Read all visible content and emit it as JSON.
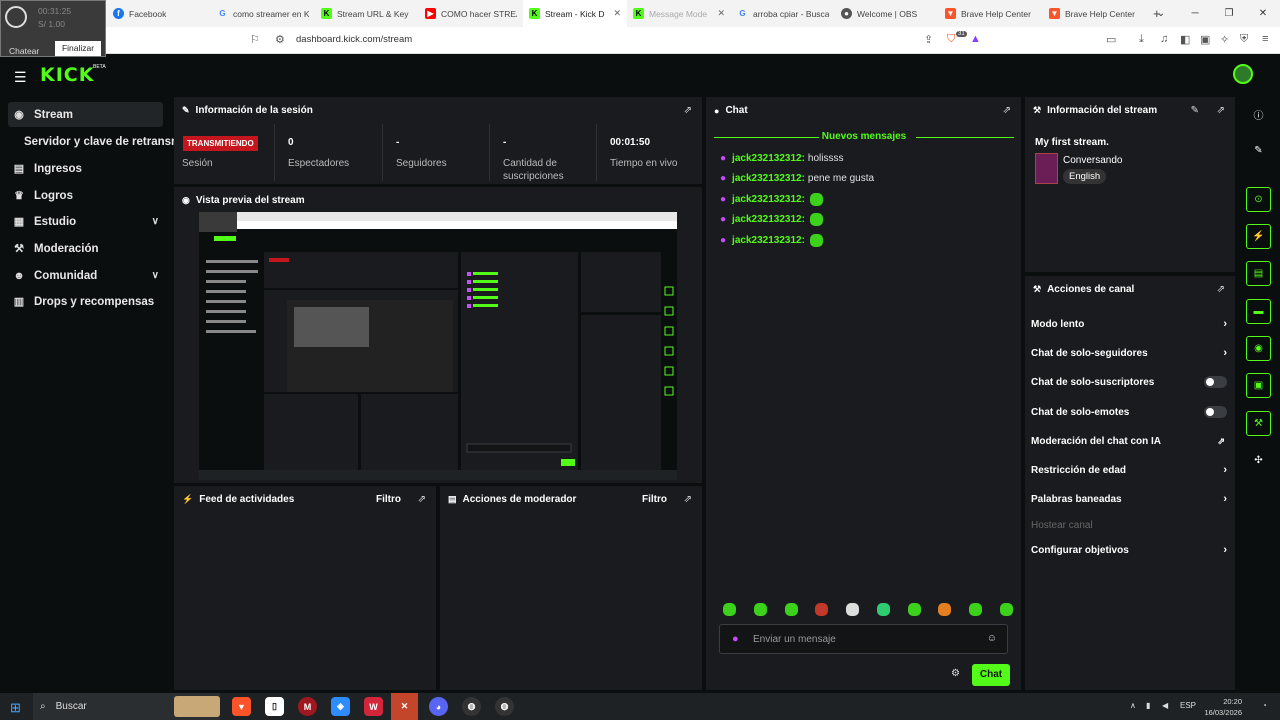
{
  "overlay": {
    "time": "00:31:25",
    "ratio": "S/ 1.00",
    "chat_label": "Chatear",
    "finish_label": "Finalizar"
  },
  "browser": {
    "tabs": [
      {
        "title": "Facebook",
        "color": "#1877f2"
      },
      {
        "title": "como streamer en K",
        "color": "#4285f4"
      },
      {
        "title": "Stream URL & Key",
        "color": "#53fc18"
      },
      {
        "title": "COMO hacer STREA",
        "color": "#ff0000"
      },
      {
        "title": "Stream - Kick D",
        "color": "#53fc18"
      },
      {
        "title": "Message Mode",
        "color": "#53fc18"
      },
      {
        "title": "arroba cpiar - Busca",
        "color": "#4285f4"
      },
      {
        "title": "Welcome | OBS",
        "color": "#555555"
      },
      {
        "title": "Brave Help Center",
        "color": "#fb542b"
      },
      {
        "title": "Brave Help Center",
        "color": "#fb542b"
      }
    ],
    "url": "dashboard.kick.com/stream",
    "shield_count": "31"
  },
  "header": {
    "logo": "KICK",
    "beta": "BETA"
  },
  "sidebar": {
    "items": [
      {
        "label": "Stream",
        "icon": "broadcast-icon"
      },
      {
        "label": "Servidor y clave de retransm"
      },
      {
        "label": "Ingresos",
        "icon": "chart-icon"
      },
      {
        "label": "Logros",
        "icon": "trophy-icon"
      },
      {
        "label": "Estudio",
        "icon": "studio-icon"
      },
      {
        "label": "Moderación",
        "icon": "wrench-icon"
      },
      {
        "label": "Comunidad",
        "icon": "community-icon"
      },
      {
        "label": "Drops y recompensas",
        "icon": "gift-icon"
      }
    ]
  },
  "session": {
    "title": "Información de la sesión",
    "badge": "TRANSMITIENDO",
    "session_label": "Sesión",
    "stats": [
      {
        "value": "0",
        "label": "Espectadores"
      },
      {
        "value": "-",
        "label": "Seguidores"
      },
      {
        "value": "-",
        "label": "Cantidad de suscripciones"
      },
      {
        "value": "00:01:50",
        "label": "Tiempo en vivo"
      }
    ]
  },
  "preview": {
    "title": "Vista previa del stream"
  },
  "activity": {
    "title": "Feed de actividades",
    "filter": "Filtro"
  },
  "modactions": {
    "title": "Acciones de moderador",
    "filter": "Filtro"
  },
  "chat": {
    "title": "Chat",
    "new_messages": "Nuevos mensajes",
    "messages": [
      {
        "user": "jack232132312:",
        "text": "holissss"
      },
      {
        "user": "jack232132312:",
        "text": "pene me gusta"
      },
      {
        "user": "jack232132312:",
        "text": ""
      },
      {
        "user": "jack232132312:",
        "text": ""
      },
      {
        "user": "jack232132312:",
        "text": ""
      }
    ],
    "placeholder": "Enviar un mensaje",
    "send_label": "Chat"
  },
  "stream_info": {
    "title": "Información del stream",
    "stream_title": "My first stream.",
    "category": "Conversando",
    "language": "English"
  },
  "channel_actions": {
    "title": "Acciones de canal",
    "items": [
      {
        "label": "Modo lento"
      },
      {
        "label": "Chat de solo-seguidores"
      },
      {
        "label": "Chat de solo-suscriptores"
      },
      {
        "label": "Chat de solo-emotes"
      },
      {
        "label": "Moderación del chat con IA"
      },
      {
        "label": "Restricción de edad"
      },
      {
        "label": "Palabras baneadas"
      },
      {
        "label": "Hostear canal"
      },
      {
        "label": "Configurar objetivos"
      }
    ]
  },
  "taskbar": {
    "search": "Buscar",
    "lang": "ESP",
    "time": "20:20",
    "date": "16/03/2026"
  }
}
